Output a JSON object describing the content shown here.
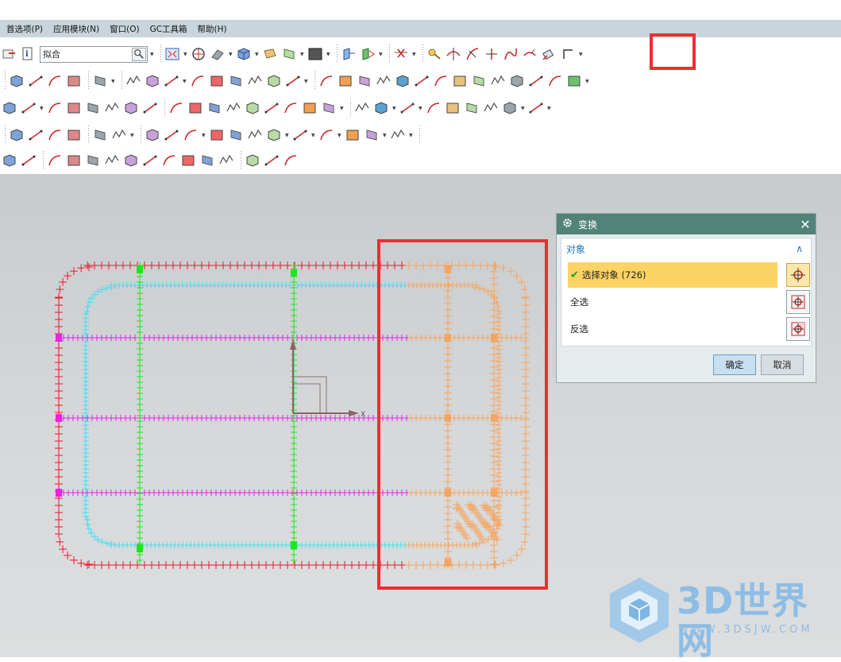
{
  "menubar": {
    "items": [
      "首选项(P)",
      "应用模块(N)",
      "窗口(O)",
      "GC工具箱",
      "帮助(H)"
    ]
  },
  "toolbar": {
    "filter_value": "拟合"
  },
  "dialog": {
    "title": "变换",
    "section_title": "对象",
    "rows": {
      "select_objects": "选择对象 (726)",
      "select_all": "全选",
      "invert_selection": "反选"
    },
    "ok_label": "确定",
    "cancel_label": "取消"
  },
  "watermark": {
    "title": "3D世界网",
    "url": "WWW.3DSJW.COM"
  },
  "axis": {
    "x_label": "X"
  },
  "colors": {
    "accent_dialog": "#528378",
    "highlight_row": "#fcd365",
    "annotation_red": "#ee2d31",
    "curve_red": "#e6192f",
    "curve_cyan": "#3fe0f0",
    "curve_magenta": "#e426e4",
    "curve_green": "#1ee61e",
    "curve_orange": "#f5a560"
  }
}
